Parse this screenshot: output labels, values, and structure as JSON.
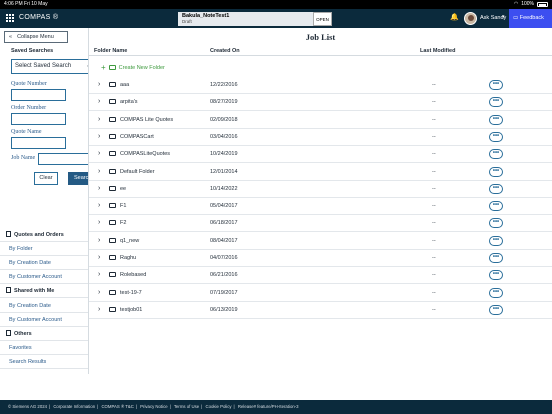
{
  "status_bar": {
    "time": "4:06 PM",
    "date": "Fri 10 May",
    "battery": "100%"
  },
  "header": {
    "app_name": "COMPAS ®",
    "quote_name": "Bakula_NoteTest1",
    "quote_state": "Draft",
    "open_label": "OPEN",
    "user_name": "Ask Sandy",
    "feedback_label": "Feedback"
  },
  "sidebar": {
    "collapse_label": "Collapse Menu",
    "saved_searches_label": "Saved Searches",
    "saved_search_placeholder": "Select Saved Search",
    "quote_number_label": "Quote Number",
    "order_number_label": "Order Number",
    "quote_name_label": "Quote Name",
    "job_name_label": "Job Name",
    "clear_label": "Clear",
    "search_label": "Search",
    "sections": [
      {
        "title": "Quotes and Orders",
        "items": [
          "By Folder",
          "By Creation Date",
          "By Customer Account"
        ]
      },
      {
        "title": "Shared with Me",
        "items": [
          "By Creation Date",
          "By Customer Account"
        ]
      },
      {
        "title": "Others",
        "items": [
          "Favorites",
          "Search Results"
        ]
      }
    ]
  },
  "main": {
    "title": "Job List",
    "columns": {
      "folder_name": "Folder Name",
      "created_on": "Created On",
      "last_modified": "Last Modified"
    },
    "create_label": "Create New Folder",
    "more_glyph": "•••",
    "rows": [
      {
        "name": "aaa",
        "created": "12/22/2016",
        "modified": "--"
      },
      {
        "name": "arpita's",
        "created": "08/27/2019",
        "modified": "--"
      },
      {
        "name": "COMPAS Lite Quotes",
        "created": "02/09/2018",
        "modified": "--"
      },
      {
        "name": "COMPASCart",
        "created": "03/04/2016",
        "modified": "--"
      },
      {
        "name": "COMPASLiteQuotes",
        "created": "10/24/2019",
        "modified": "--"
      },
      {
        "name": "Default Folder",
        "created": "12/01/2014",
        "modified": "--"
      },
      {
        "name": "ee",
        "created": "10/14/2022",
        "modified": "--"
      },
      {
        "name": "F1",
        "created": "05/04/2017",
        "modified": "--"
      },
      {
        "name": "F2",
        "created": "06/18/2017",
        "modified": "--"
      },
      {
        "name": "q1_new",
        "created": "08/04/2017",
        "modified": "--"
      },
      {
        "name": "Raghu",
        "created": "04/07/2016",
        "modified": "--"
      },
      {
        "name": "Rolebased",
        "created": "06/21/2016",
        "modified": "--"
      },
      {
        "name": "test-19-7",
        "created": "07/19/2017",
        "modified": "--"
      },
      {
        "name": "testjob01",
        "created": "06/13/2019",
        "modified": "--"
      }
    ]
  },
  "footer": {
    "links": [
      "© Siemens AG 2024",
      "Corporate Information",
      "COMPAS ® T&C",
      "Privacy Notice",
      "Terms of Use",
      "Cookie Policy",
      "Release# feature/PH-Iteration-3"
    ],
    "separator": "|"
  }
}
